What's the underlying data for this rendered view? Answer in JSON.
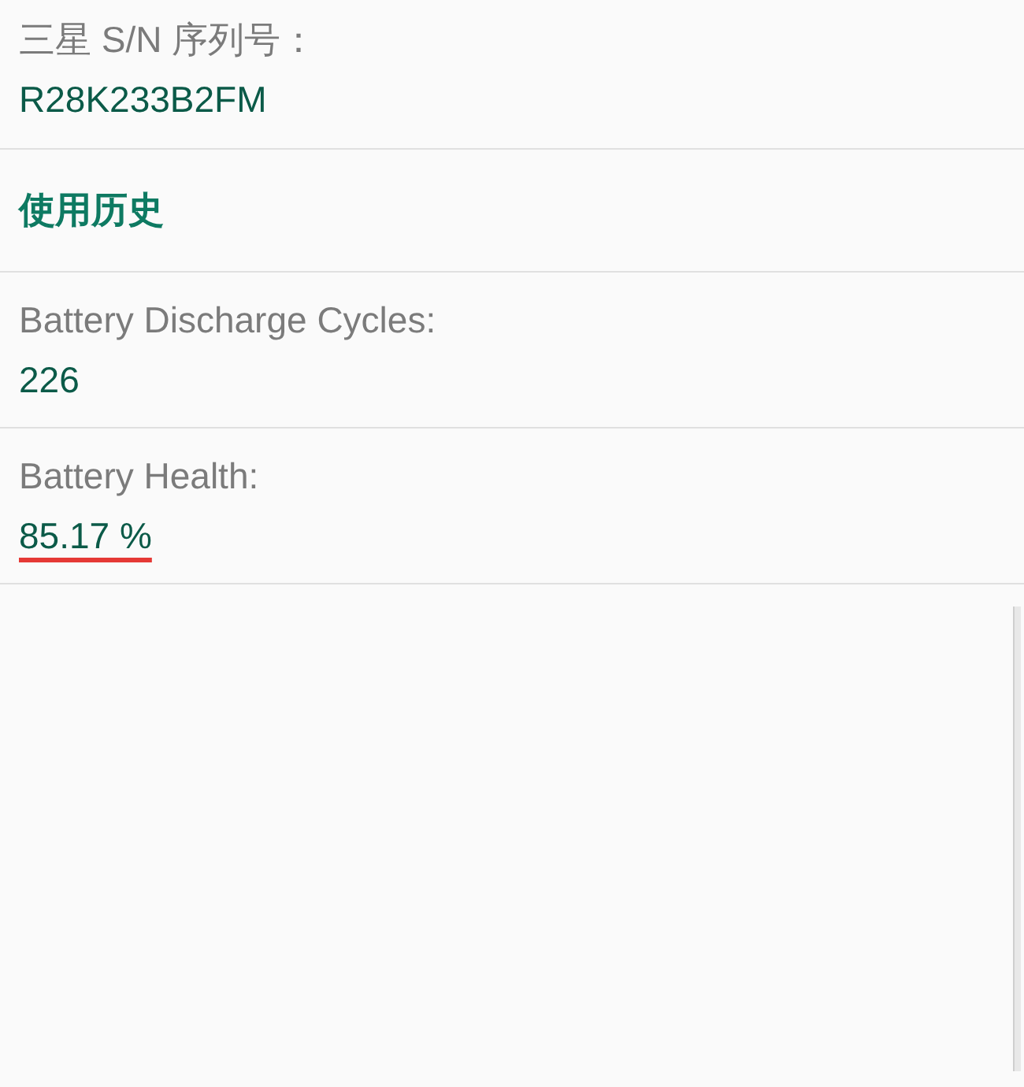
{
  "items": [
    {
      "kind": "field",
      "label": "三星 S/N 序列号：",
      "value": "R28K233B2FM",
      "highlighted": false
    },
    {
      "kind": "header",
      "label": "使用历史"
    },
    {
      "kind": "field",
      "label": "Battery Discharge Cycles:",
      "value": "226",
      "highlighted": false
    },
    {
      "kind": "field",
      "label": "Battery Health:",
      "value": "85.17 %",
      "highlighted": true
    }
  ]
}
